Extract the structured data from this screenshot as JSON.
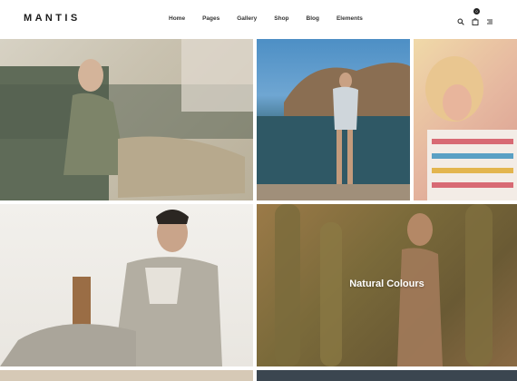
{
  "header": {
    "logo": "MANTIS",
    "nav": [
      "Home",
      "Pages",
      "Gallery",
      "Shop",
      "Blog",
      "Elements"
    ],
    "cart_count": "0"
  },
  "gallery": {
    "featured_caption": "Natural Colours"
  }
}
